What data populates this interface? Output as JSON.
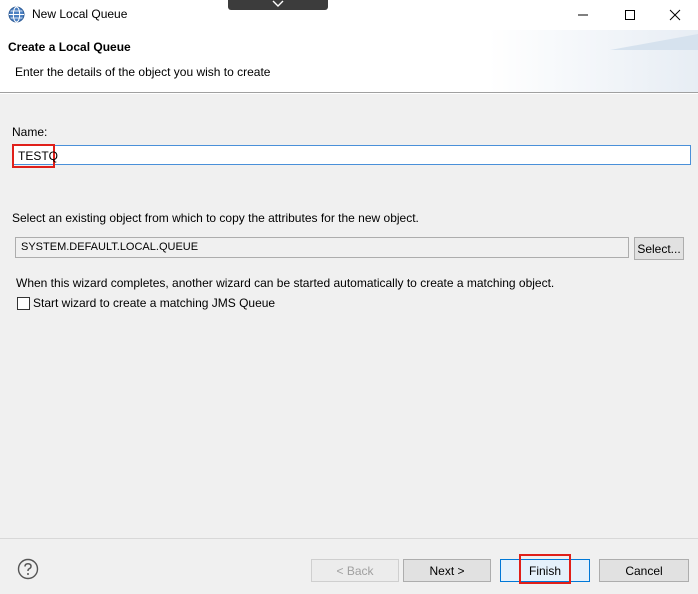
{
  "window": {
    "title": "New Local Queue"
  },
  "header": {
    "title": "Create a Local Queue",
    "description": "Enter the details of the object you wish to create"
  },
  "form": {
    "name_label": "Name:",
    "name_value": "TESTQ",
    "copy_label": "Select an existing object from which to copy the attributes for the new object.",
    "copy_value": "SYSTEM.DEFAULT.LOCAL.QUEUE",
    "select_button": "Select...",
    "wizard_info": "When this wizard completes, another wizard can be started automatically to create a matching object.",
    "wizard_checkbox_label": "Start wizard to create a matching JMS Queue",
    "wizard_checkbox_checked": false
  },
  "footer": {
    "back_label": "< Back",
    "next_label": "Next >",
    "finish_label": "Finish",
    "cancel_label": "Cancel"
  },
  "colors": {
    "highlight": "#e0201a",
    "focus_border": "#0078d7"
  },
  "icons": {
    "app": "globe-icon",
    "help": "help-icon",
    "minimize": "minimize-icon",
    "maximize": "maximize-icon",
    "close": "close-icon",
    "dropdown": "chevron-down-icon"
  }
}
